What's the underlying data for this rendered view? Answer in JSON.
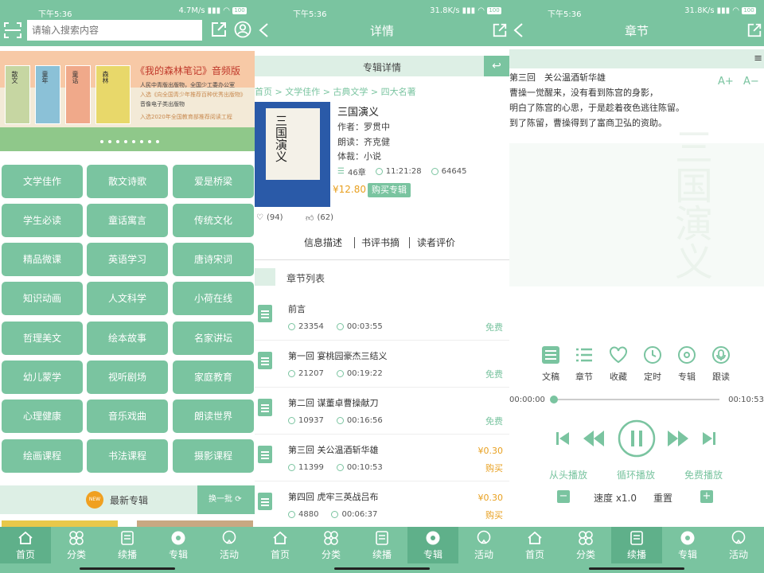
{
  "colors": {
    "accent": "#7ac4a0",
    "accent_dark": "#5fb08a",
    "price": "#e8a020"
  },
  "status": {
    "s1": {
      "time": "下午5:36",
      "speed": "4.7M/s",
      "battery": "100"
    },
    "s2": {
      "time": "下午5:36",
      "speed": "31.8K/s",
      "battery": "100"
    },
    "s3": {
      "time": "下午5:36",
      "speed": "31.8K/s",
      "battery": "100"
    }
  },
  "tabs": [
    "首页",
    "分类",
    "续播",
    "专辑",
    "活动"
  ],
  "home": {
    "search_placeholder": "请输入搜索内容",
    "banner": {
      "title": "《我的森林笔记》音频版",
      "line1": "人民中青版出版物，全国少工委办公室",
      "line2": "入选《向全国青少年推荐百种优秀出版物》",
      "line3": "音像电子类出版物",
      "line4": "入选2020年全国教育部推荐阅读工程",
      "books": [
        "散文",
        "童年",
        "童话",
        "森林"
      ]
    },
    "categories": [
      "文学佳作",
      "散文诗歌",
      "爱是桥梁",
      "学生必读",
      "童话寓言",
      "传统文化",
      "精品微课",
      "英语学习",
      "唐诗宋词",
      "知识动画",
      "人文科学",
      "小荷在线",
      "哲理美文",
      "绘本故事",
      "名家讲坛",
      "幼儿蒙学",
      "视听剧场",
      "家庭教育",
      "心理健康",
      "音乐戏曲",
      "朗读世界",
      "绘画课程",
      "书法课程",
      "摄影课程"
    ],
    "latest": {
      "badge": "NEW",
      "title": "最新专辑",
      "refresh": "换一批"
    }
  },
  "detail": {
    "nav_title": "详情",
    "section_title": "专辑详情",
    "breadcrumb": "首页 > 文学佳作 > 古典文学 > 四大名著",
    "cover_text": "三国演义",
    "album_title": "三国演义",
    "author": "作者：罗贯中",
    "reader": "朗读：齐克健",
    "genre": "体裁：小说",
    "chapters": "46章",
    "duration": "11:21:28",
    "plays": "64645",
    "price": "¥12.80",
    "buy_label": "购买专辑",
    "likes": "(94)",
    "thumbs": "(62)",
    "subtabs": [
      "信息描述",
      "书评书摘",
      "读者评价"
    ],
    "list_title": "章节列表",
    "chapter_list": [
      {
        "title": "前言",
        "plays": "23354",
        "time": "00:03:55",
        "price": "",
        "status": "免费"
      },
      {
        "title": "第一回 宴桃园豪杰三结义",
        "plays": "21207",
        "time": "00:19:22",
        "price": "",
        "status": "免费"
      },
      {
        "title": "第二回 谋董卓曹操献刀",
        "plays": "10937",
        "time": "00:16:56",
        "price": "",
        "status": "免费"
      },
      {
        "title": "第三回 关公温酒斩华雄",
        "plays": "11399",
        "time": "00:10:53",
        "price": "¥0.30",
        "status": "购买"
      },
      {
        "title": "第四回 虎牢三英战吕布",
        "plays": "4880",
        "time": "00:06:37",
        "price": "¥0.30",
        "status": "购买"
      }
    ]
  },
  "chapter": {
    "nav_title": "章节",
    "chapter_heading": "第三回　关公温酒斩华雄",
    "text_lines": [
      "曹操一觉醒来，没有看到陈宫的身影，",
      "明白了陈宫的心思，于是趁着夜色逃往陈留。",
      "到了陈留，曹操得到了富商卫弘的资助。"
    ],
    "font_plus": "A+",
    "font_minus": "A−",
    "controls": [
      "文稿",
      "章节",
      "收藏",
      "定时",
      "专辑",
      "跟读"
    ],
    "time_start": "00:00:00",
    "time_end": "00:10:53",
    "progress": 0,
    "modes": [
      "从头播放",
      "循环播放",
      "免费播放"
    ],
    "speed": "速度 x1.0",
    "reset": "重置",
    "minus": "−",
    "plus": "+"
  }
}
